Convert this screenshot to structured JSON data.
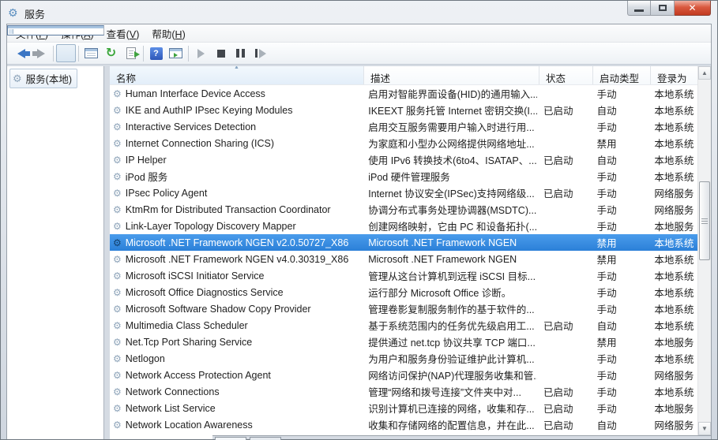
{
  "window": {
    "title": "服务"
  },
  "titlebar_controls": {
    "minimize": "minimize",
    "maximize": "maximize",
    "close": "close"
  },
  "menu_items": [
    {
      "pre": "文件(",
      "key": "F",
      "post": ")"
    },
    {
      "pre": "操作(",
      "key": "A",
      "post": ")"
    },
    {
      "pre": "查看(",
      "key": "V",
      "post": ")"
    },
    {
      "pre": "帮助(",
      "key": "H",
      "post": ")"
    }
  ],
  "toolbar_icons": [
    "back-arrow",
    "forward-arrow",
    "show-console-tree",
    "properties-window",
    "refresh",
    "export-list",
    "help",
    "extended-view",
    "start-service",
    "stop-service",
    "pause-service",
    "resume-service"
  ],
  "sidebar": {
    "selected_item": {
      "icon": "services-gear",
      "label": "服务(本地)"
    }
  },
  "table": {
    "columns": [
      {
        "label": "名称",
        "sorted": "asc"
      },
      {
        "label": "描述"
      },
      {
        "label": "状态"
      },
      {
        "label": "启动类型"
      },
      {
        "label": "登录为"
      }
    ]
  },
  "rows": [
    {
      "name": "Human Interface Device Access",
      "desc": "启用对智能界面设备(HID)的通用输入...",
      "status": "",
      "startup": "手动",
      "logon": "本地系统",
      "selected": false
    },
    {
      "name": "IKE and AuthIP IPsec Keying Modules",
      "desc": "IKEEXT 服务托管 Internet 密钥交换(I...",
      "status": "已启动",
      "startup": "自动",
      "logon": "本地系统",
      "selected": false
    },
    {
      "name": "Interactive Services Detection",
      "desc": "启用交互服务需要用户输入时进行用...",
      "status": "",
      "startup": "手动",
      "logon": "本地系统",
      "selected": false
    },
    {
      "name": "Internet Connection Sharing (ICS)",
      "desc": "为家庭和小型办公网络提供网络地址...",
      "status": "",
      "startup": "禁用",
      "logon": "本地系统",
      "selected": false
    },
    {
      "name": "IP Helper",
      "desc": "使用 IPv6 转换技术(6to4、ISATAP、...",
      "status": "已启动",
      "startup": "自动",
      "logon": "本地系统",
      "selected": false
    },
    {
      "name": "iPod 服务",
      "desc": "iPod 硬件管理服务",
      "status": "",
      "startup": "手动",
      "logon": "本地系统",
      "selected": false
    },
    {
      "name": "IPsec Policy Agent",
      "desc": "Internet 协议安全(IPSec)支持网络级...",
      "status": "已启动",
      "startup": "手动",
      "logon": "网络服务",
      "selected": false
    },
    {
      "name": "KtmRm for Distributed Transaction Coordinator",
      "desc": "协调分布式事务处理协调器(MSDTC)...",
      "status": "",
      "startup": "手动",
      "logon": "网络服务",
      "selected": false
    },
    {
      "name": "Link-Layer Topology Discovery Mapper",
      "desc": "创建网络映射，它由 PC 和设备拓扑(...",
      "status": "",
      "startup": "手动",
      "logon": "本地服务",
      "selected": false
    },
    {
      "name": "Microsoft .NET Framework NGEN v2.0.50727_X86",
      "desc": "Microsoft .NET Framework NGEN",
      "status": "",
      "startup": "禁用",
      "logon": "本地系统",
      "selected": true
    },
    {
      "name": "Microsoft .NET Framework NGEN v4.0.30319_X86",
      "desc": "Microsoft .NET Framework NGEN",
      "status": "",
      "startup": "禁用",
      "logon": "本地系统",
      "selected": false
    },
    {
      "name": "Microsoft iSCSI Initiator Service",
      "desc": "管理从这台计算机到远程 iSCSI 目标...",
      "status": "",
      "startup": "手动",
      "logon": "本地系统",
      "selected": false
    },
    {
      "name": "Microsoft Office Diagnostics Service",
      "desc": "运行部分 Microsoft Office 诊断。",
      "status": "",
      "startup": "手动",
      "logon": "本地系统",
      "selected": false
    },
    {
      "name": "Microsoft Software Shadow Copy Provider",
      "desc": "管理卷影复制服务制作的基于软件的...",
      "status": "",
      "startup": "手动",
      "logon": "本地系统",
      "selected": false
    },
    {
      "name": "Multimedia Class Scheduler",
      "desc": "基于系统范围内的任务优先级启用工...",
      "status": "已启动",
      "startup": "自动",
      "logon": "本地系统",
      "selected": false
    },
    {
      "name": "Net.Tcp Port Sharing Service",
      "desc": "提供通过 net.tcp 协议共享 TCP 端口...",
      "status": "",
      "startup": "禁用",
      "logon": "本地服务",
      "selected": false
    },
    {
      "name": "Netlogon",
      "desc": "为用户和服务身份验证维护此计算机...",
      "status": "",
      "startup": "手动",
      "logon": "本地系统",
      "selected": false
    },
    {
      "name": "Network Access Protection Agent",
      "desc": "网络访问保护(NAP)代理服务收集和管...",
      "status": "",
      "startup": "手动",
      "logon": "网络服务",
      "selected": false
    },
    {
      "name": "Network Connections",
      "desc": "管理“网络和拨号连接”文件夹中对...",
      "status": "已启动",
      "startup": "手动",
      "logon": "本地系统",
      "selected": false
    },
    {
      "name": "Network List Service",
      "desc": "识别计算机已连接的网络，收集和存...",
      "status": "已启动",
      "startup": "手动",
      "logon": "本地服务",
      "selected": false
    },
    {
      "name": "Network Location Awareness",
      "desc": "收集和存储网络的配置信息，并在此...",
      "status": "已启动",
      "startup": "自动",
      "logon": "网络服务",
      "selected": false
    }
  ],
  "colors": {
    "selection_blue": "#3a91e5",
    "selection_text": "#ffffff",
    "close_button_red": "#cf4e39",
    "help_icon_blue": "#3a6fd8",
    "refresh_green": "#3aa63a",
    "back_arrow_blue": "#3b76c4"
  }
}
